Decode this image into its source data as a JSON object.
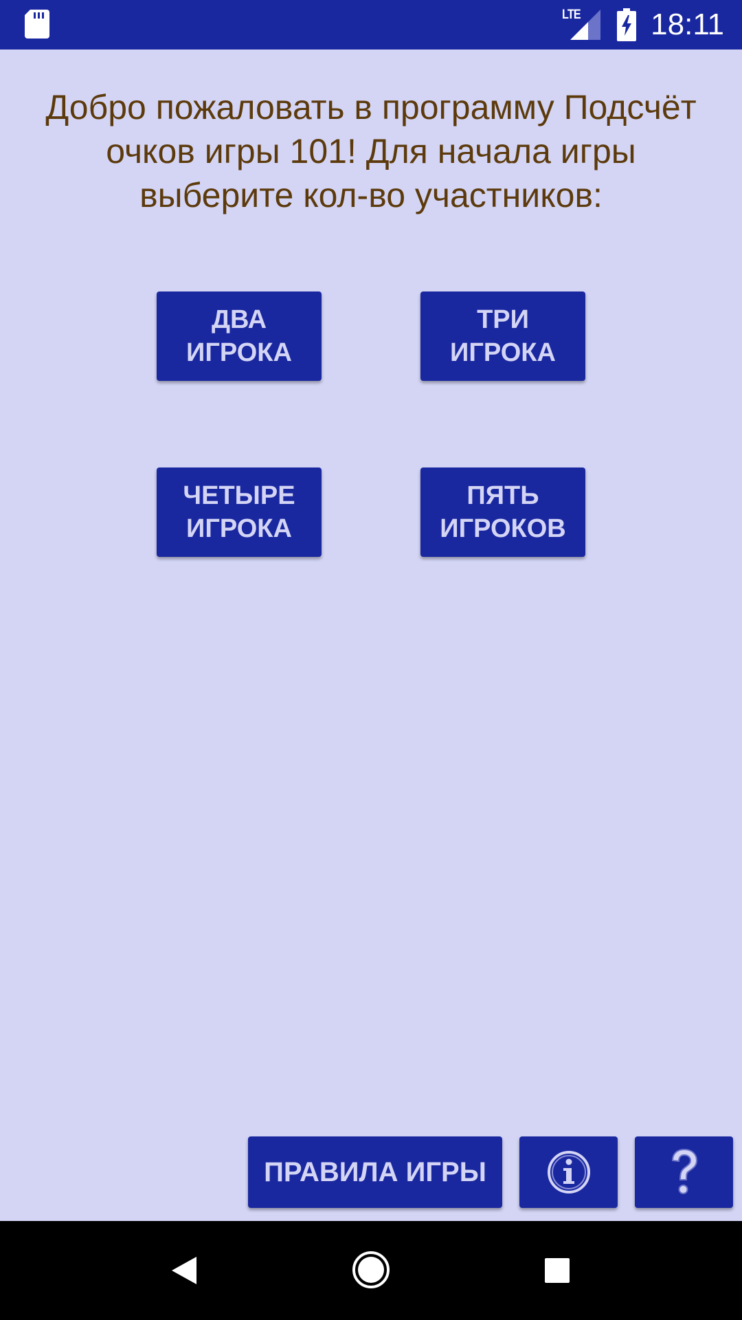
{
  "status_bar": {
    "time": "18:11",
    "network_label": "LTE",
    "icons": [
      "sd-card-icon",
      "signal-icon",
      "battery-charging-icon"
    ]
  },
  "welcome_text": "Добро пожаловать в программу Подсчёт очков игры 101! Для начала игры выберите кол-во участников:",
  "player_buttons": [
    {
      "line1": "ДВА",
      "line2": "ИГРОКА"
    },
    {
      "line1": "ТРИ",
      "line2": "ИГРОКА"
    },
    {
      "line1": "ЧЕТЫРЕ",
      "line2": "ИГРОКА"
    },
    {
      "line1": "ПЯТЬ",
      "line2": "ИГРОКОВ"
    }
  ],
  "bottom_bar": {
    "rules_label": "ПРАВИЛА ИГРЫ",
    "info_icon": "info-icon",
    "help_icon": "question-mark-icon"
  },
  "nav_bar": {
    "icons": [
      "back-icon",
      "home-icon",
      "recents-icon"
    ]
  },
  "colors": {
    "primary": "#1a28a0",
    "background": "#d4d5f5",
    "text_brown": "#5c3a0c",
    "button_text": "#d4d5f5"
  }
}
